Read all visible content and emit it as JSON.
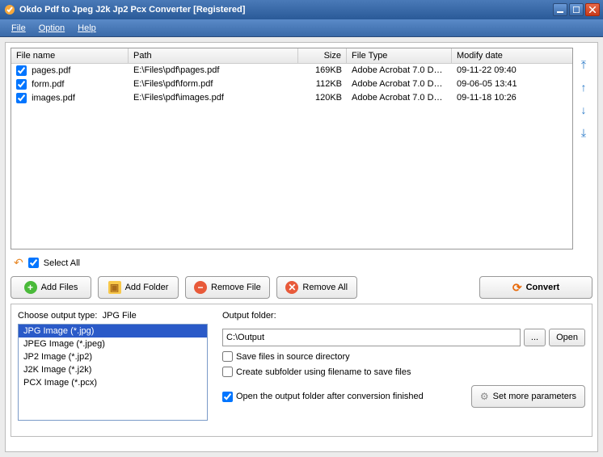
{
  "title": "Okdo Pdf to Jpeg J2k Jp2 Pcx Converter [Registered]",
  "menu": {
    "file": "File",
    "option": "Option",
    "help": "Help"
  },
  "columns": {
    "name": "File name",
    "path": "Path",
    "size": "Size",
    "type": "File Type",
    "date": "Modify date"
  },
  "files": [
    {
      "checked": true,
      "name": "pages.pdf",
      "path": "E:\\Files\\pdf\\pages.pdf",
      "size": "169KB",
      "type": "Adobe Acrobat 7.0 Doc...",
      "date": "09-11-22 09:40"
    },
    {
      "checked": true,
      "name": "form.pdf",
      "path": "E:\\Files\\pdf\\form.pdf",
      "size": "112KB",
      "type": "Adobe Acrobat 7.0 Doc...",
      "date": "09-06-05 13:41"
    },
    {
      "checked": true,
      "name": "images.pdf",
      "path": "E:\\Files\\pdf\\images.pdf",
      "size": "120KB",
      "type": "Adobe Acrobat 7.0 Doc...",
      "date": "09-11-18 10:26"
    }
  ],
  "selectAll": {
    "label": "Select All",
    "checked": true
  },
  "buttons": {
    "addFiles": "Add Files",
    "addFolder": "Add Folder",
    "removeFile": "Remove File",
    "removeAll": "Remove All",
    "convert": "Convert",
    "browse": "...",
    "open": "Open",
    "setMore": "Set more parameters"
  },
  "outputType": {
    "label": "Choose output type:",
    "current": "JPG File",
    "items": [
      "JPG Image (*.jpg)",
      "JPEG Image (*.jpeg)",
      "JP2 Image (*.jp2)",
      "J2K Image (*.j2k)",
      "PCX Image (*.pcx)"
    ],
    "selectedIndex": 0
  },
  "outputFolder": {
    "label": "Output folder:",
    "value": "C:\\Output"
  },
  "options": {
    "saveInSource": {
      "label": "Save files in source directory",
      "checked": false
    },
    "createSubfolder": {
      "label": "Create subfolder using filename to save files",
      "checked": false
    },
    "openAfter": {
      "label": "Open the output folder after conversion finished",
      "checked": true
    }
  }
}
